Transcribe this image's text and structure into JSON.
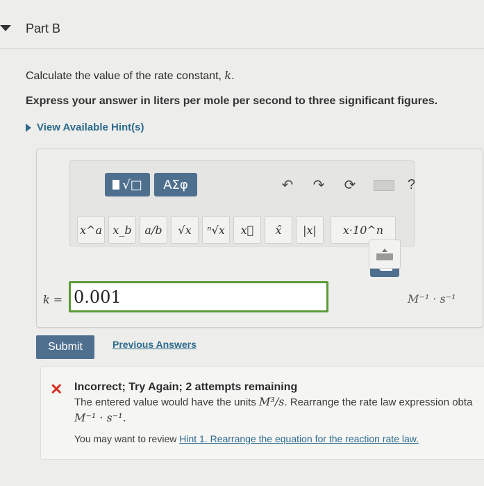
{
  "part": {
    "title": "Part B"
  },
  "question": {
    "prefix": "Calculate the value of the rate constant, ",
    "variable": "k",
    "suffix": ".",
    "instruction": "Express your answer in liters per mole per second to three significant figures.",
    "hint_link": "View Available Hint(s)"
  },
  "toolbar": {
    "greek_label": "ΑΣφ",
    "help_label": "?",
    "math_buttons": [
      "x^a",
      "x_b",
      "a/b",
      "√x",
      "ⁿ√x",
      "x⃗",
      "x̂",
      "|x|",
      "x·10^n"
    ]
  },
  "answer": {
    "label_var": "k",
    "label_eq": " = ",
    "value": "0.001",
    "units": "M⁻¹ · s⁻¹"
  },
  "actions": {
    "submit_label": "Submit",
    "previous_label": "Previous Answers"
  },
  "feedback": {
    "title": "Incorrect; Try Again; 2 attempts remaining",
    "line1_prefix": "The entered value would have the units ",
    "line1_units": "M³/s",
    "line1_suffix": ". Rearrange the rate law expression obta",
    "units_line": "M⁻¹ · s⁻¹.",
    "review_prefix": "You may want to review ",
    "review_link": "Hint 1. Rearrange the equation for the reaction rate law."
  },
  "colors": {
    "accent": "#4f6f8f",
    "link": "#2c6a8d",
    "answer_border": "#5b9b36",
    "error": "#d72d1e"
  }
}
